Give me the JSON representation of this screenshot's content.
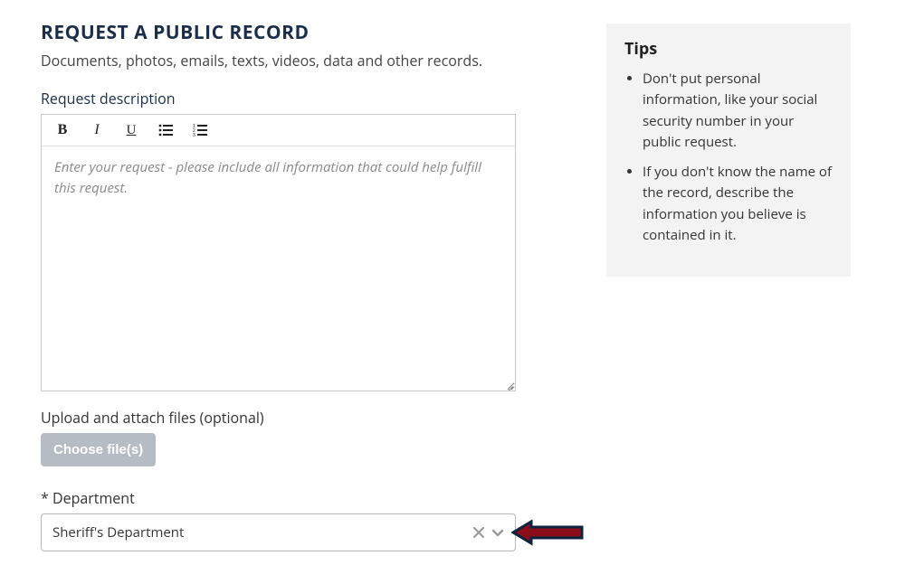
{
  "header": {
    "title": "REQUEST A PUBLIC RECORD",
    "subtitle": "Documents, photos, emails, texts, videos, data and other records."
  },
  "request": {
    "label": "Request description",
    "placeholder": "Enter your request - please include all information that could help fulfill this request."
  },
  "toolbar": {
    "bold": "B",
    "italic": "I",
    "underline": "U"
  },
  "upload": {
    "label": "Upload and attach files (optional)",
    "button": "Choose file(s)"
  },
  "department": {
    "label": "* Department",
    "value": "Sheriff's Department"
  },
  "tips": {
    "title": "Tips",
    "items": [
      "Don't put personal information, like your social security number in your public request.",
      "If you don't know the name of the record, describe the information you believe is contained in it."
    ]
  },
  "colors": {
    "labelDark": "#1a2e4a",
    "panelBg": "#f3f3f3",
    "buttonDisabled": "#b6bcc4",
    "arrowFill": "#8b0d1a",
    "arrowStroke": "#0c2340"
  }
}
